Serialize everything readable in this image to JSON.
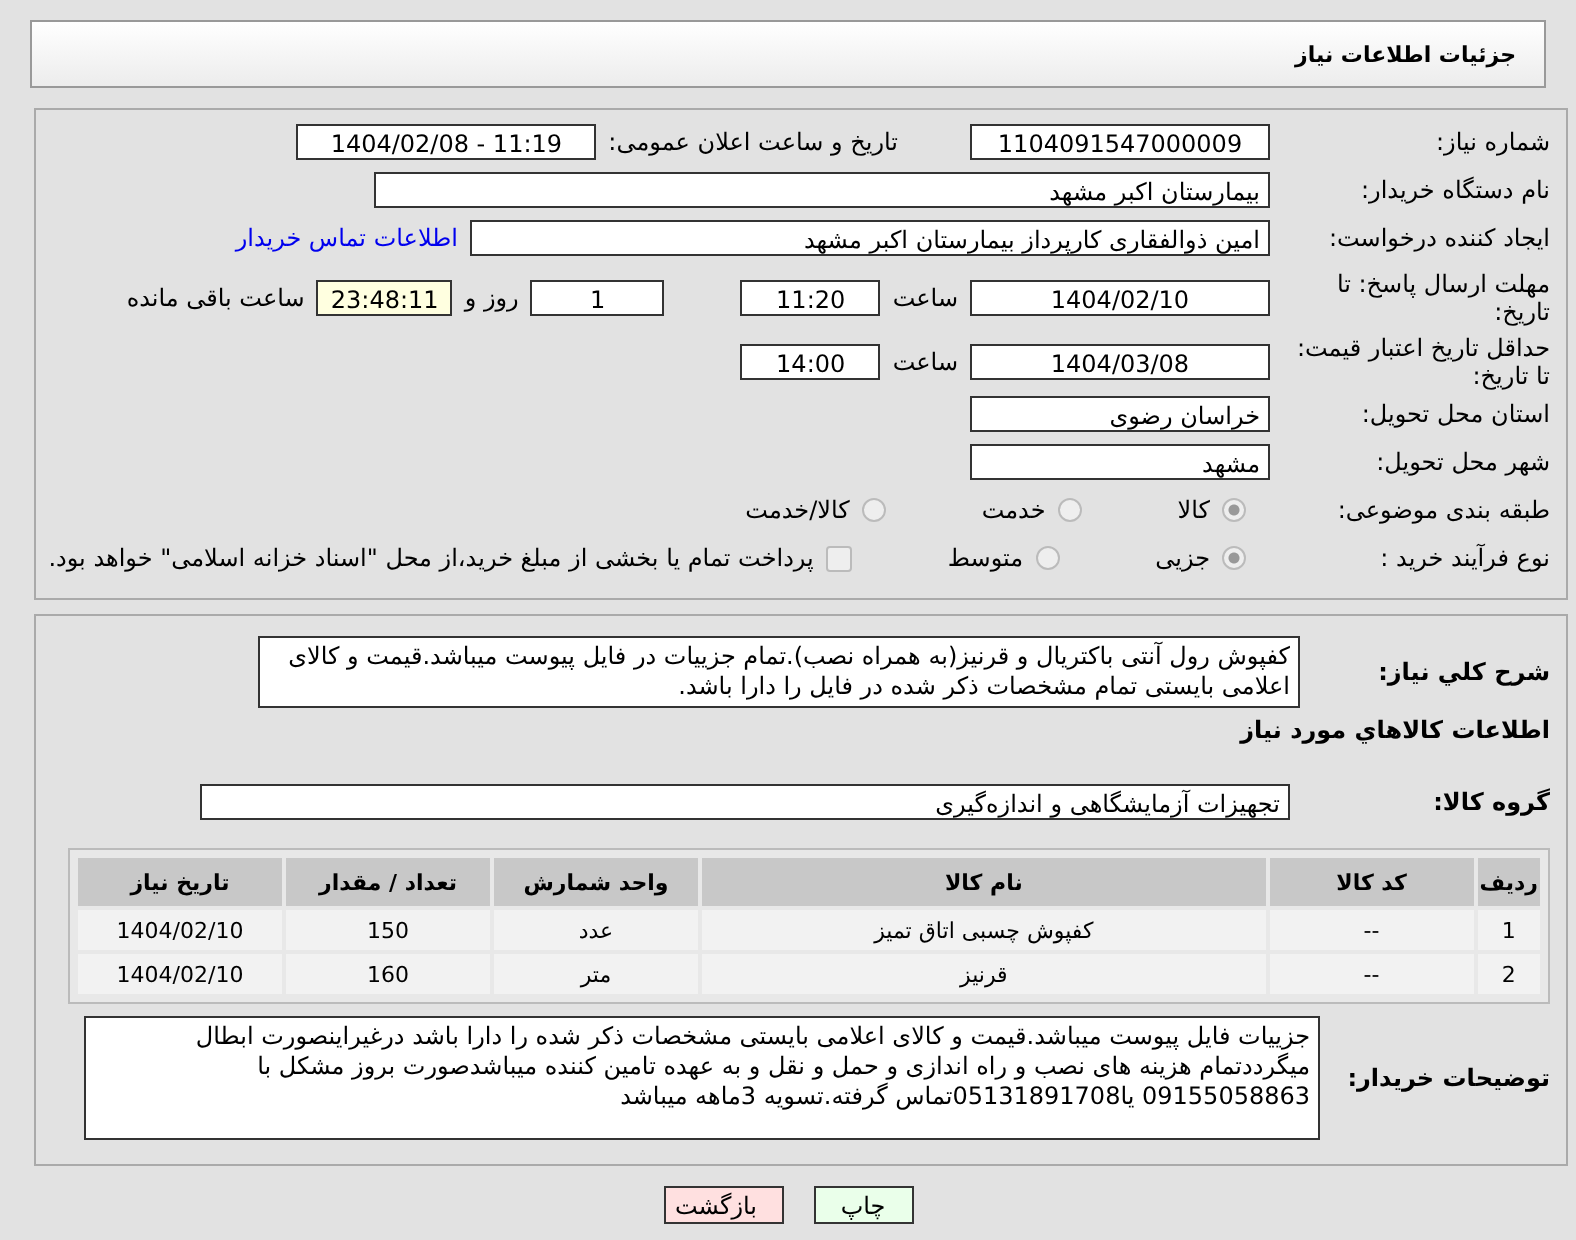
{
  "header": {
    "title": "جزئیات اطلاعات نیاز"
  },
  "need_number": {
    "label": "شماره نیاز:",
    "value": "1104091547000009"
  },
  "announce": {
    "label": "تاریخ و ساعت اعلان عمومی:",
    "value": "1404/02/08 - 11:19"
  },
  "buyer_org": {
    "label": "نام دستگاه خریدار:",
    "value": "بیمارستان اکبر مشهد"
  },
  "requester": {
    "label": "ایجاد کننده درخواست:",
    "value": "امین ذوالفقاری کارپرداز بیمارستان اکبر مشهد",
    "link": "اطلاعات تماس خریدار"
  },
  "deadline": {
    "label": "مهلت ارسال پاسخ: تا تاریخ:",
    "date": "1404/02/10",
    "time_label": "ساعت",
    "time": "11:20",
    "days": "1",
    "days_label": "روز و",
    "remaining": "23:48:11",
    "remaining_label": "ساعت باقی مانده"
  },
  "validity": {
    "label": "حداقل تاریخ اعتبار قیمت: تا تاریخ:",
    "date": "1404/03/08",
    "time_label": "ساعت",
    "time": "14:00"
  },
  "province": {
    "label": "استان محل تحویل:",
    "value": "خراسان رضوی"
  },
  "city": {
    "label": "شهر محل تحویل:",
    "value": "مشهد"
  },
  "category": {
    "label": "طبقه بندی موضوعی:",
    "options": [
      {
        "label": "کالا",
        "selected": true
      },
      {
        "label": "خدمت",
        "selected": false
      },
      {
        "label": "کالا/خدمت",
        "selected": false
      }
    ]
  },
  "process": {
    "label": "نوع فرآیند خرید :",
    "options": [
      {
        "label": "جزیی",
        "selected": true
      },
      {
        "label": "متوسط",
        "selected": false
      }
    ],
    "payment_note": {
      "text": "پرداخت تمام یا بخشی از مبلغ خرید،از محل \"اسناد خزانه اسلامی\" خواهد بود.",
      "checked": false
    }
  },
  "description": {
    "label": "شرح کلي نياز:",
    "value": "کفپوش  رول آنتی باکتریال  و قرنیز(به همراه نصب).تمام جزییات در فایل پیوست میباشد.قیمت و کالای اعلامی بایستی تمام مشخصات ذکر شده در فایل را دارا باشد."
  },
  "goods_heading": "اطلاعات کالاهاي مورد نياز",
  "goods_group": {
    "label": "گروه کالا:",
    "value": "تجهیزات آزمایشگاهی و اندازه‌گیری"
  },
  "table": {
    "columns": [
      "ردیف",
      "کد کالا",
      "نام کالا",
      "واحد شمارش",
      "تعداد / مقدار",
      "تاریخ نیاز"
    ],
    "rows": [
      [
        "1",
        "--",
        "کفپوش چسبی اتاق تمیز",
        "عدد",
        "150",
        "1404/02/10"
      ],
      [
        "2",
        "--",
        "قرنیز",
        "متر",
        "160",
        "1404/02/10"
      ]
    ]
  },
  "buyer_notes": {
    "label": "توضیحات خریدار:",
    "value": "جزییات فایل پیوست میباشد.قیمت و کالای اعلامی بایستی مشخصات ذکر شده را دارا باشد درغیراینصورت ابطال میگرددتمام هزینه های نصب و راه اندازی و حمل و نقل و به عهده تامین کننده میباشدصورت بروز مشکل با 09155058863 یا05131891708تماس گرفته.تسویه 3ماهه میباشد"
  },
  "buttons": [
    {
      "label": "چاپ",
      "kind": "print"
    },
    {
      "label": "بازگشت",
      "kind": "back"
    }
  ]
}
